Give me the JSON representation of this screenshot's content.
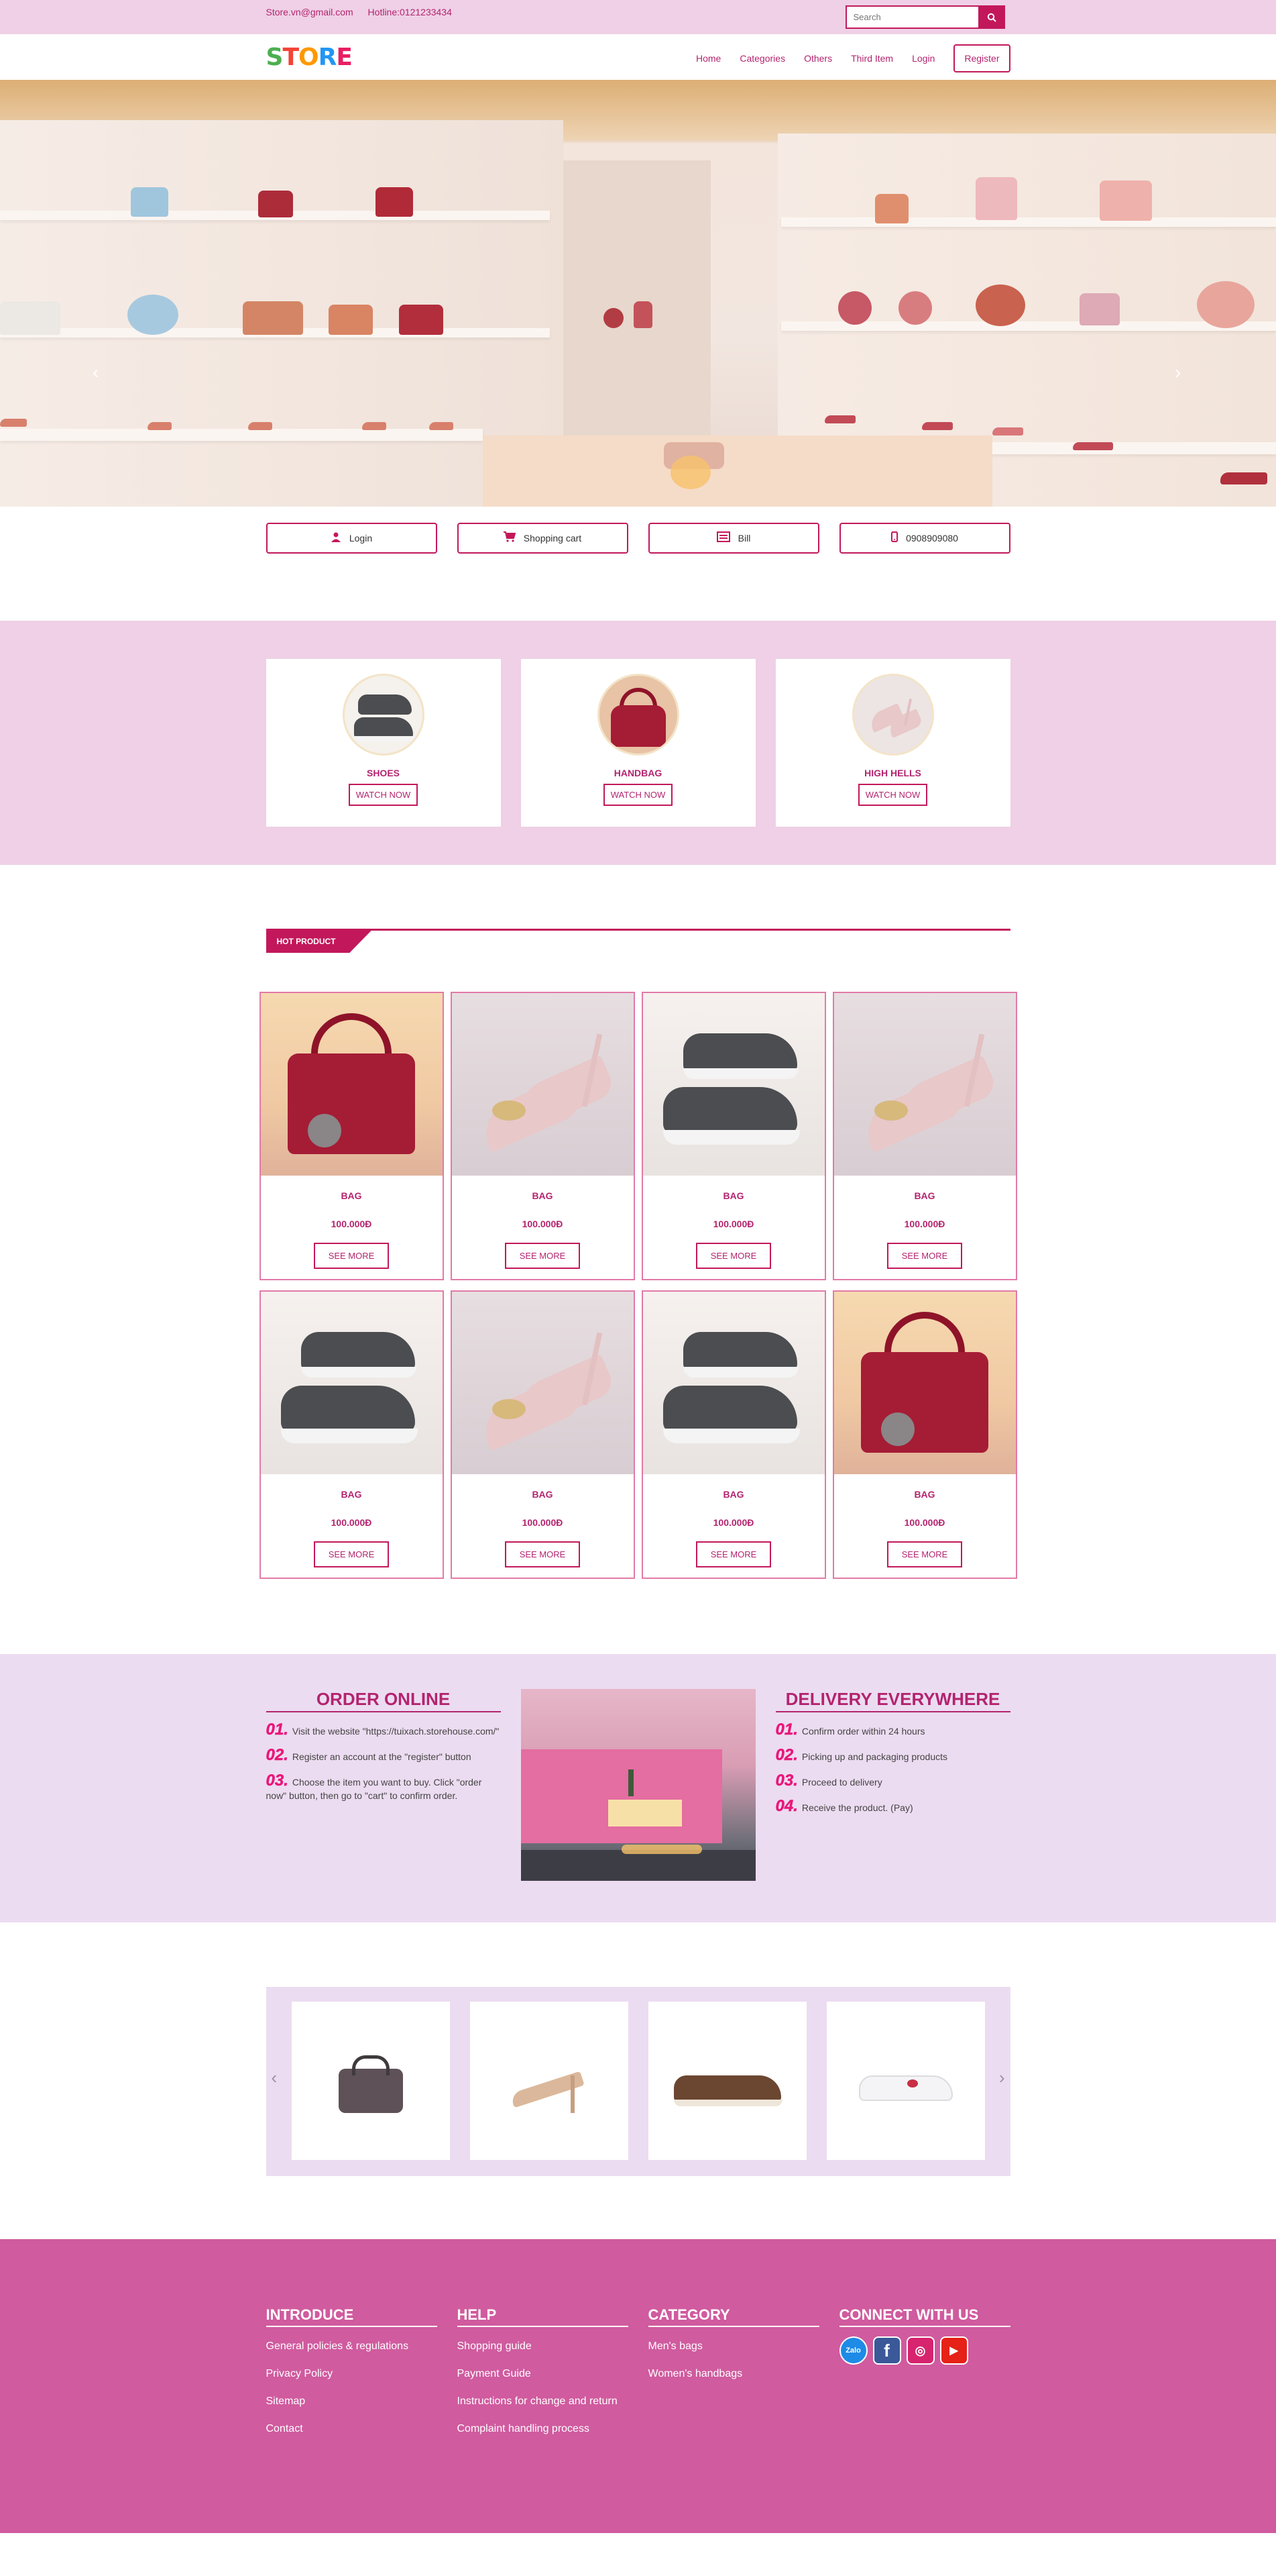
{
  "topbar": {
    "email": "Store.vn@gmail.com",
    "hotline": "Hotline:0121233434",
    "search_placeholder": "Search"
  },
  "nav": {
    "logo": [
      "S",
      "T",
      "O",
      "R",
      "E"
    ],
    "items": [
      "Home",
      "Categories",
      "Others",
      "Third Item",
      "Login"
    ],
    "register": "Register"
  },
  "hero": {
    "prev": "‹",
    "next": "›"
  },
  "quick_links": [
    {
      "label": "Login",
      "icon": "user-icon"
    },
    {
      "label": "Shopping cart",
      "icon": "cart-icon"
    },
    {
      "label": "Bill",
      "icon": "bill-icon"
    },
    {
      "label": "0908909080",
      "icon": "phone-icon"
    }
  ],
  "categories": [
    {
      "title": "SHOES",
      "button": "WATCH NOW"
    },
    {
      "title": "HANDBAG",
      "button": "WATCH NOW"
    },
    {
      "title": "HIGH HELLS",
      "button": "WATCH NOW"
    }
  ],
  "hot": {
    "tag": "HOT PRODUCT",
    "products": [
      {
        "name": "BAG",
        "price": "100.000Đ",
        "button": "SEE MORE",
        "image": "bag"
      },
      {
        "name": "BAG",
        "price": "100.000Đ",
        "button": "SEE MORE",
        "image": "heel"
      },
      {
        "name": "BAG",
        "price": "100.000Đ",
        "button": "SEE MORE",
        "image": "shoe"
      },
      {
        "name": "BAG",
        "price": "100.000Đ",
        "button": "SEE MORE",
        "image": "heel"
      },
      {
        "name": "BAG",
        "price": "100.000Đ",
        "button": "SEE MORE",
        "image": "shoe"
      },
      {
        "name": "BAG",
        "price": "100.000Đ",
        "button": "SEE MORE",
        "image": "heel"
      },
      {
        "name": "BAG",
        "price": "100.000Đ",
        "button": "SEE MORE",
        "image": "shoe"
      },
      {
        "name": "BAG",
        "price": "100.000Đ",
        "button": "SEE MORE",
        "image": "bag"
      }
    ]
  },
  "order": {
    "title": "ORDER ONLINE",
    "steps": [
      {
        "num": "01.",
        "text": "Visit the website \"https://tuixach.storehouse.com/\""
      },
      {
        "num": "02.",
        "text": "Register an account at the \"register\" button"
      },
      {
        "num": "03.",
        "text": "Choose the item you want to buy. Click \"order now\" button, then go to \"cart\" to confirm order."
      }
    ]
  },
  "delivery": {
    "title": "DELIVERY EVERYWHERE",
    "steps": [
      {
        "num": "01.",
        "text": "Confirm order within 24 hours"
      },
      {
        "num": "02.",
        "text": "Picking up and packaging products"
      },
      {
        "num": "03.",
        "text": "Proceed to delivery"
      },
      {
        "num": "04.",
        "text": "Receive the product. (Pay)"
      }
    ]
  },
  "carousel": {
    "prev": "‹",
    "next": "›"
  },
  "footer": {
    "introduce": {
      "title": "INTRODUCE",
      "links": [
        "General policies & regulations",
        "Privacy Policy",
        "Sitemap",
        "Contact"
      ]
    },
    "help": {
      "title": "HELP",
      "links": [
        "Shopping guide",
        "Payment Guide",
        "Instructions for change and return",
        "Complaint handling process"
      ]
    },
    "category": {
      "title": "CATEGORY",
      "links": [
        "Men's bags",
        "Women's handbags"
      ]
    },
    "connect": {
      "title": "CONNECT WITH US",
      "zalo": "Zalo",
      "facebook": "f",
      "instagram": "◎",
      "youtube": "▶"
    }
  },
  "colors": {
    "accent": "#c2185b",
    "topbar": "#efd0e6",
    "lavender": "#ecdcf1",
    "footer": "#d05b9f"
  }
}
